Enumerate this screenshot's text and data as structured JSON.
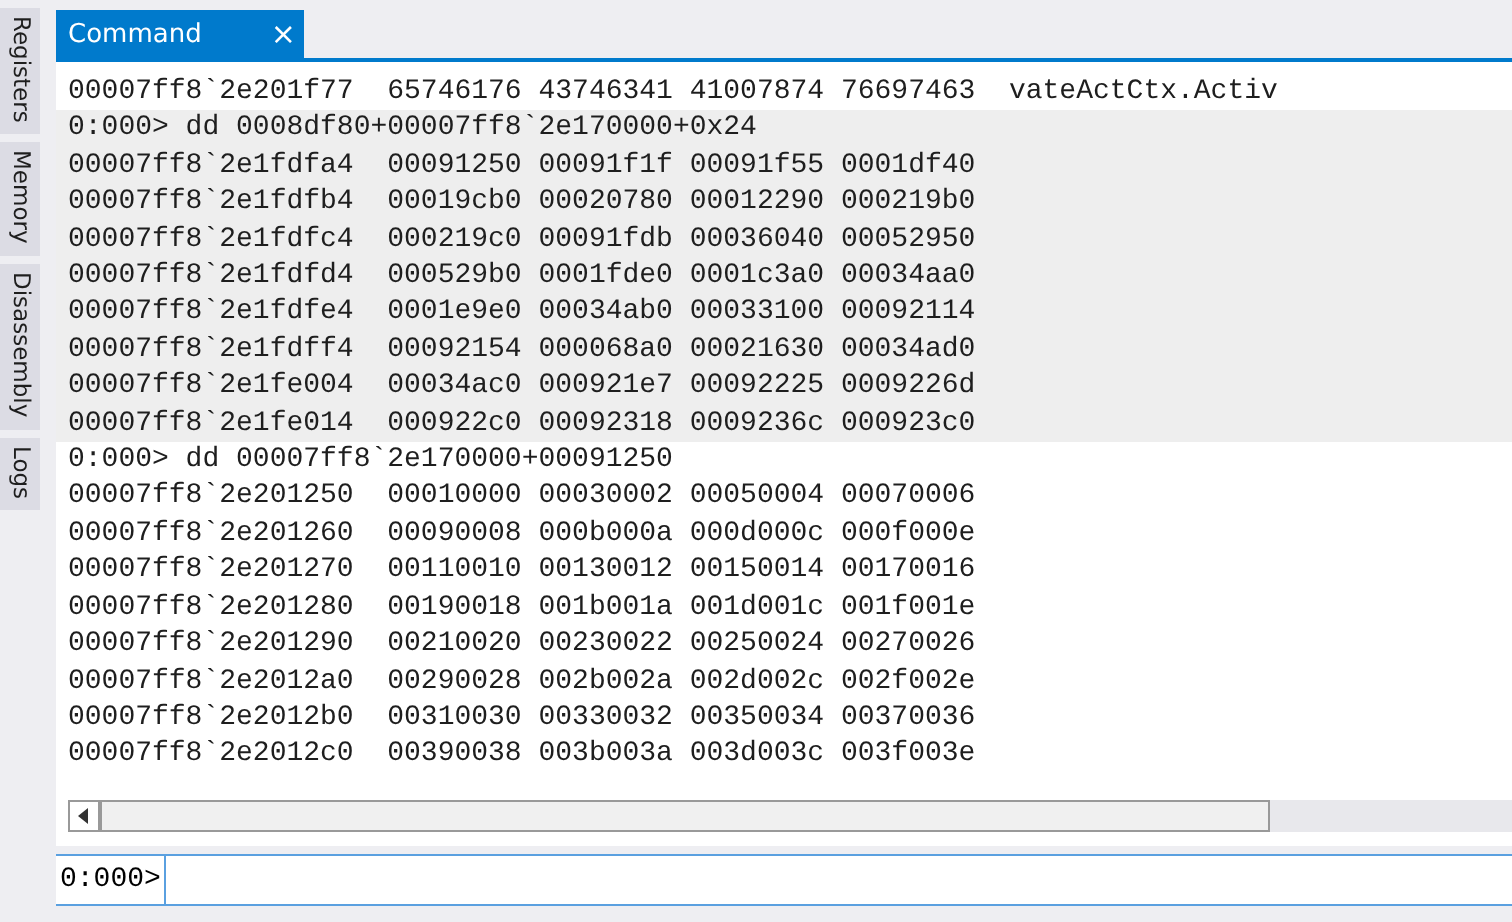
{
  "side_tabs": [
    {
      "label": "Registers"
    },
    {
      "label": "Memory"
    },
    {
      "label": "Disassembly"
    },
    {
      "label": "Logs"
    }
  ],
  "tabs": [
    {
      "label": "Command",
      "selected": true,
      "close": "×"
    }
  ],
  "output": [
    {
      "highlighted": false,
      "lines": [
        "00007ff8`2e201f77  65746176 43746341 41007874 76697463  vateActCtx.Activ"
      ]
    },
    {
      "highlighted": true,
      "lines": [
        "0:000> dd 0008df80+00007ff8`2e170000+0x24",
        "00007ff8`2e1fdfa4  00091250 00091f1f 00091f55 0001df40",
        "00007ff8`2e1fdfb4  00019cb0 00020780 00012290 000219b0",
        "00007ff8`2e1fdfc4  000219c0 00091fdb 00036040 00052950",
        "00007ff8`2e1fdfd4  000529b0 0001fde0 0001c3a0 00034aa0",
        "00007ff8`2e1fdfe4  0001e9e0 00034ab0 00033100 00092114",
        "00007ff8`2e1fdff4  00092154 000068a0 00021630 00034ad0",
        "00007ff8`2e1fe004  00034ac0 000921e7 00092225 0009226d",
        "00007ff8`2e1fe014  000922c0 00092318 0009236c 000923c0"
      ]
    },
    {
      "highlighted": false,
      "lines": [
        "0:000> dd 00007ff8`2e170000+00091250",
        "00007ff8`2e201250  00010000 00030002 00050004 00070006",
        "00007ff8`2e201260  00090008 000b000a 000d000c 000f000e",
        "00007ff8`2e201270  00110010 00130012 00150014 00170016",
        "00007ff8`2e201280  00190018 001b001a 001d001c 001f001e",
        "00007ff8`2e201290  00210020 00230022 00250024 00270026",
        "00007ff8`2e2012a0  00290028 002b002a 002d002c 002f002e",
        "00007ff8`2e2012b0  00310030 00330032 00350034 00370036",
        "00007ff8`2e2012c0  00390038 003b003a 003d003c 003f003e"
      ]
    }
  ],
  "prompt": "0:000>"
}
